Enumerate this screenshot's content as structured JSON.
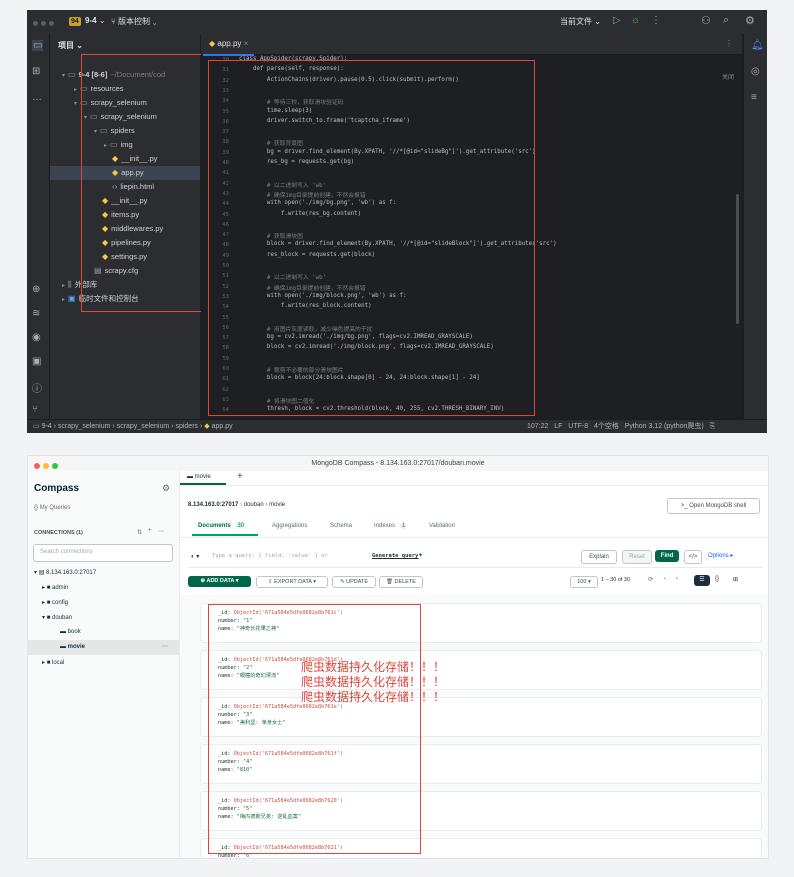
{
  "ide": {
    "project_badge": "94",
    "project_name": "9-4",
    "vcs": "版本控制",
    "current_file": "当前文件",
    "panel_title": "项目",
    "tab_name": "app.py",
    "close_hint": "关闭",
    "tree": [
      {
        "label": "9-4 [8-6]",
        "suffix": "~/Document/cod",
        "icon": "folder-icon"
      },
      {
        "label": "resources",
        "icon": "folder-icon"
      },
      {
        "label": "scrapy_selenium",
        "icon": "folder-icon"
      },
      {
        "label": "scrapy_selenium",
        "icon": "folder-icon"
      },
      {
        "label": "spiders",
        "icon": "folder-icon"
      },
      {
        "label": "img",
        "icon": "folder-icon"
      },
      {
        "label": "__init__.py",
        "icon": "python-file-icon"
      },
      {
        "label": "app.py",
        "icon": "python-file-icon"
      },
      {
        "label": "liepin.html",
        "icon": "html-file-icon"
      },
      {
        "label": "__init__.py",
        "icon": "python-file-icon"
      },
      {
        "label": "items.py",
        "icon": "python-file-icon"
      },
      {
        "label": "middlewares.py",
        "icon": "python-file-icon"
      },
      {
        "label": "pipelines.py",
        "icon": "python-file-icon"
      },
      {
        "label": "settings.py",
        "icon": "python-file-icon"
      },
      {
        "label": "scrapy.cfg",
        "icon": "file-icon"
      },
      {
        "label": "外部库",
        "icon": "library-icon"
      },
      {
        "label": "临时文件和控制台",
        "icon": "console-icon"
      }
    ],
    "code_lines": [
      "class AppSpider(scrapy.Spider):",
      "    def parse(self, response):",
      "        ActionChains(driver).pause(0.5).click(submit).perform()",
      "",
      "        # 等待三秒，获取滑块验证码",
      "        time.sleep(3)",
      "        driver.switch_to.frame('tcaptcha_iframe')",
      "",
      "        # 获取背景图",
      "        bg = driver.find_element(By.XPATH, '//*[@id=\"slideBg\"]').get_attribute('src')",
      "        res_bg = requests.get(bg)",
      "",
      "        # 以二进制写入 'wb'",
      "        # 确保img目录提前创建，不然会报错",
      "        with open('./img/bg.png', 'wb') as f:",
      "            f.write(res_bg.content)",
      "",
      "        # 获取滑块图",
      "        block = driver.find_element(By.XPATH, '//*[@id=\"slideBlock\"]').get_attribute('src')",
      "        res_block = requests.get(block)",
      "",
      "        # 以二进制写入 'wb'",
      "        # 确保img目录提前创建，不然会报错",
      "        with open('./img/block.png', 'wb') as f:",
      "            f.write(res_block.content)",
      "",
      "        # 用图片灰度读取，减少噪色提高的干扰",
      "        bg = cv2.imread('./img/bg.png', flags=cv2.IMREAD_GRAYSCALE)",
      "        block = cv2.imread('./img/block.png', flags=cv2.IMREAD_GRAYSCALE)",
      "",
      "        # 裁剪不必要的部分滑块图片",
      "        block = block[24:block.shape[0] - 24, 24:block.shape[1] - 24]",
      "",
      "        # 将滑块图二值化",
      "        thresh, block = cv2.threshold(block, 40, 255, cv2.THRESH_BINARY_INV)"
    ],
    "line_numbers": [
      "30",
      "31",
      "32",
      "33",
      "34",
      "35",
      "36",
      "37",
      "38",
      "39",
      "40",
      "41",
      "42",
      "43",
      "44",
      "45",
      "46",
      "47",
      "48",
      "49",
      "50",
      "51",
      "52",
      "53",
      "54",
      "55",
      "56",
      "57",
      "58",
      "59",
      "60",
      "61",
      "62",
      "63",
      "64"
    ],
    "breadcrumb": [
      "9-4",
      "scrapy_selenium",
      "scrapy_selenium",
      "spiders",
      "app.py"
    ],
    "status": {
      "pos": "107:22",
      "eol": "LF",
      "enc": "UTF-8",
      "indent": "4个空格",
      "interp": "Python 3.12 (python爬虫)"
    }
  },
  "compass": {
    "title": "MongoDB Compass - 8.134.163.0:27017/douban.movie",
    "tab": "movie",
    "brand": "Compass",
    "my_queries": "My Queries",
    "connections": "CONNECTIONS (1)",
    "search_placeholder": "Search connections",
    "tree": {
      "host": "8.134.163.0:27017",
      "dbs": [
        "admin",
        "config",
        "douban"
      ],
      "collections": [
        "book",
        "movie"
      ],
      "local": "local"
    },
    "breadcrumb": {
      "host": "8.134.163.0:27017",
      "db": "douban",
      "coll": "movie"
    },
    "shell_button": "Open MongoDB shell",
    "subtabs": {
      "documents": "Documents",
      "documents_count": "30",
      "aggregations": "Aggregations",
      "schema": "Schema",
      "indexes": "Indexes",
      "indexes_count": "1",
      "validation": "Validation"
    },
    "query_placeholder": "Type a query: { field: 'value' } or",
    "generate_query": "Generate query",
    "explain": "Explain",
    "reset": "Reset",
    "find": "Find",
    "options": "Options",
    "add_data": "ADD DATA",
    "export_data": "EXPORT DATA",
    "update": "UPDATE",
    "delete": "DELETE",
    "page_size": "100",
    "page_range": "1 – 30 of 30",
    "docs": [
      {
        "id": "ObjectId('671a584e5dfe0682e8b761c')",
        "number": "\"1\"",
        "name": "\"神奇长花果之神\""
      },
      {
        "id": "ObjectId('671a584e5dfe0682e8b761d')",
        "number": "\"2\"",
        "name": "\"眼瞳的奇幻漂流\""
      },
      {
        "id": "ObjectId('671a584e5dfe0682e8b761e')",
        "number": "\"3\"",
        "name": "\"美利坚: 单身女士\""
      },
      {
        "id": "ObjectId('671a584e5dfe0682e8b761f')",
        "number": "\"4\"",
        "name": "\"810\""
      },
      {
        "id": "ObjectId('671a584e5dfe0682e8b7620')",
        "number": "\"5\"",
        "name": "\"梅内德斯兄弟: 逆乱血案\""
      },
      {
        "id": "ObjectId('671a584e5dfe0682e8b7621')",
        "number": "\"6\"",
        "name": ""
      }
    ],
    "note_lines": [
      "爬虫数据持久化存储！！！",
      "爬虫数据持久化存储！！！",
      "爬虫数据持久化存储！！！"
    ]
  }
}
